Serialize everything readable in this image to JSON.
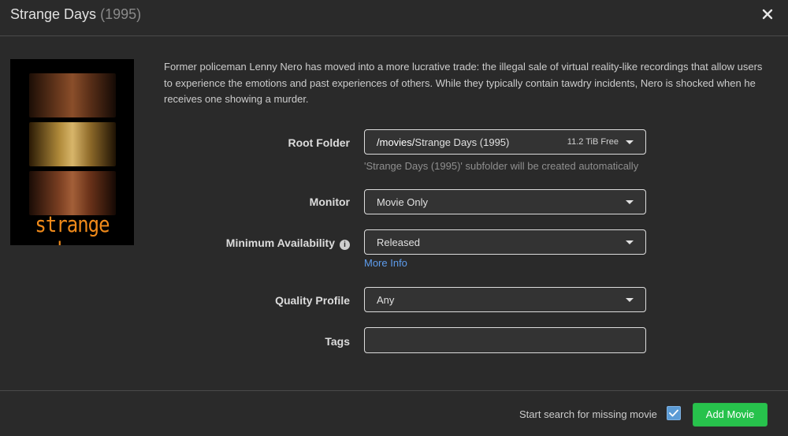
{
  "modal": {
    "title": "Strange Days",
    "year": "(1995)"
  },
  "poster": {
    "title_text": "strange days"
  },
  "overview": "Former policeman Lenny Nero has moved into a more lucrative trade: the illegal sale of virtual reality-like recordings that allow users to experience the emotions and past experiences of others. While they typically contain tawdry incidents, Nero is shocked when he receives one showing a murder.",
  "form": {
    "root_folder": {
      "label": "Root Folder",
      "root": "/movies/",
      "subfolder": "Strange Days (1995)",
      "free_space": "11.2 TiB Free",
      "help": "'Strange Days (1995)' subfolder will be created automatically"
    },
    "monitor": {
      "label": "Monitor",
      "value": "Movie Only"
    },
    "minimum_availability": {
      "label": "Minimum Availability",
      "value": "Released",
      "more_info": "More Info"
    },
    "quality_profile": {
      "label": "Quality Profile",
      "value": "Any"
    },
    "tags": {
      "label": "Tags",
      "value": ""
    }
  },
  "footer": {
    "search_label": "Start search for missing movie",
    "search_checked": true,
    "add_button": "Add Movie"
  },
  "colors": {
    "background": "#2a2a2a",
    "accent_green": "#27c24c",
    "link_blue": "#5d9cec",
    "checkbox_blue": "#5b9bd5"
  }
}
